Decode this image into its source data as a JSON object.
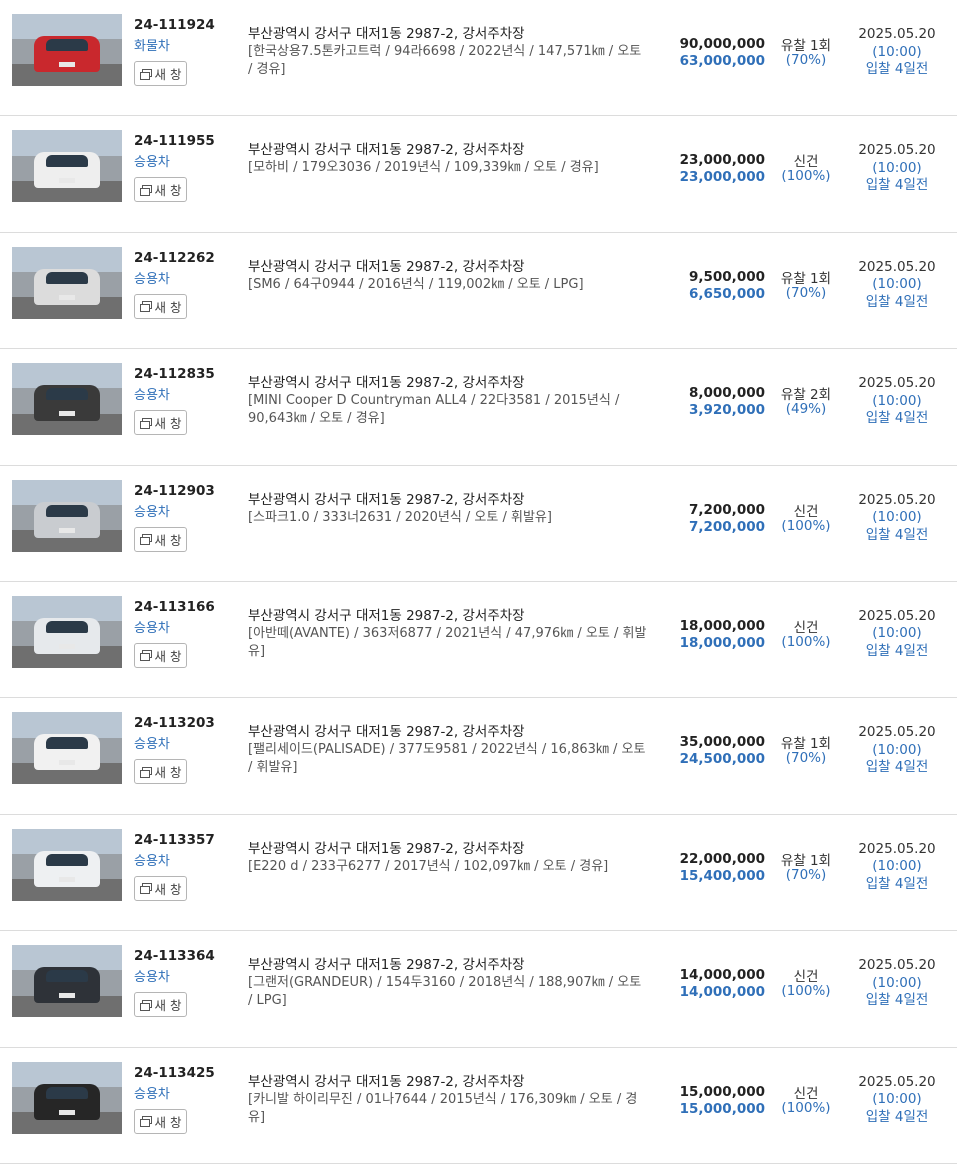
{
  "new_window_label": "새 창",
  "items": [
    {
      "case_no": "24-111924",
      "category": "화물차",
      "address": "부산광역시 강서구 대저1동 2987-2, 강서주차장",
      "spec": "[한국상용7.5톤카고트럭 / 94라6698 / 2022년식 / 147,571㎞ / 오토 / 경유]",
      "appraisal": "90,000,000",
      "min_price": "63,000,000",
      "status": "유찰 1회",
      "percent": "(70%)",
      "date": "2025.05.20",
      "time": "(10:00)",
      "remain": "입찰 4일전",
      "photo_icon": "red-truck-photo",
      "car_color": "#c9282d"
    },
    {
      "case_no": "24-111955",
      "category": "승용차",
      "address": "부산광역시 강서구 대저1동 2987-2, 강서주차장",
      "spec": "[모하비 / 179오3036 / 2019년식 / 109,339㎞ / 오토 / 경유]",
      "appraisal": "23,000,000",
      "min_price": "23,000,000",
      "status": "신건",
      "percent": "(100%)",
      "date": "2025.05.20",
      "time": "(10:00)",
      "remain": "입찰 4일전",
      "photo_icon": "white-suv-photo",
      "car_color": "#eeeeee"
    },
    {
      "case_no": "24-112262",
      "category": "승용차",
      "address": "부산광역시 강서구 대저1동 2987-2, 강서주차장",
      "spec": "[SM6 / 64구0944 / 2016년식 / 119,002㎞ / 오토 / LPG]",
      "appraisal": "9,500,000",
      "min_price": "6,650,000",
      "status": "유찰 1회",
      "percent": "(70%)",
      "date": "2025.05.20",
      "time": "(10:00)",
      "remain": "입찰 4일전",
      "photo_icon": "silver-sedan-photo",
      "car_color": "#dcdcdc"
    },
    {
      "case_no": "24-112835",
      "category": "승용차",
      "address": "부산광역시 강서구 대저1동 2987-2, 강서주차장",
      "spec": "[MINI Cooper D Countryman ALL4 / 22다3581 / 2015년식 / 90,643㎞ / 오토 / 경유]",
      "appraisal": "8,000,000",
      "min_price": "3,920,000",
      "status": "유찰 2회",
      "percent": "(49%)",
      "date": "2025.05.20",
      "time": "(10:00)",
      "remain": "입찰 4일전",
      "photo_icon": "dark-mini-photo",
      "car_color": "#3a3a3a"
    },
    {
      "case_no": "24-112903",
      "category": "승용차",
      "address": "부산광역시 강서구 대저1동 2987-2, 강서주차장",
      "spec": "[스파크1.0 / 333너2631 / 2020년식 / 오토 / 휘발유]",
      "appraisal": "7,200,000",
      "min_price": "7,200,000",
      "status": "신건",
      "percent": "(100%)",
      "date": "2025.05.20",
      "time": "(10:00)",
      "remain": "입찰 4일전",
      "photo_icon": "silver-hatchback-photo",
      "car_color": "#c9ccd0"
    },
    {
      "case_no": "24-113166",
      "category": "승용차",
      "address": "부산광역시 강서구 대저1동 2987-2, 강서주차장",
      "spec": "[아반떼(AVANTE) / 363저6877 / 2021년식 / 47,976㎞ / 오토 / 휘발유]",
      "appraisal": "18,000,000",
      "min_price": "18,000,000",
      "status": "신건",
      "percent": "(100%)",
      "date": "2025.05.20",
      "time": "(10:00)",
      "remain": "입찰 4일전",
      "photo_icon": "white-sedan-photo",
      "car_color": "#e6e9ec"
    },
    {
      "case_no": "24-113203",
      "category": "승용차",
      "address": "부산광역시 강서구 대저1동 2987-2, 강서주차장",
      "spec": "[팰리세이드(PALISADE) / 377도9581 / 2022년식 / 16,863㎞ / 오토 / 휘발유]",
      "appraisal": "35,000,000",
      "min_price": "24,500,000",
      "status": "유찰 1회",
      "percent": "(70%)",
      "date": "2025.05.20",
      "time": "(10:00)",
      "remain": "입찰 4일전",
      "photo_icon": "white-suv-photo",
      "car_color": "#f1f1f1"
    },
    {
      "case_no": "24-113357",
      "category": "승용차",
      "address": "부산광역시 강서구 대저1동 2987-2, 강서주차장",
      "spec": "[E220 d / 233구6277 / 2017년식 / 102,097㎞ / 오토 / 경유]",
      "appraisal": "22,000,000",
      "min_price": "15,400,000",
      "status": "유찰 1회",
      "percent": "(70%)",
      "date": "2025.05.20",
      "time": "(10:00)",
      "remain": "입찰 4일전",
      "photo_icon": "white-sedan-photo",
      "car_color": "#eef0f2"
    },
    {
      "case_no": "24-113364",
      "category": "승용차",
      "address": "부산광역시 강서구 대저1동 2987-2, 강서주차장",
      "spec": "[그랜저(GRANDEUR) / 154두3160 / 2018년식 / 188,907㎞ / 오토 / LPG]",
      "appraisal": "14,000,000",
      "min_price": "14,000,000",
      "status": "신건",
      "percent": "(100%)",
      "date": "2025.05.20",
      "time": "(10:00)",
      "remain": "입찰 4일전",
      "photo_icon": "dark-sedan-photo",
      "car_color": "#2e3238"
    },
    {
      "case_no": "24-113425",
      "category": "승용차",
      "address": "부산광역시 강서구 대저1동 2987-2, 강서주차장",
      "spec": "[카니발 하이리무진 / 01나7644 / 2015년식 / 176,309㎞ / 오토 / 경유]",
      "appraisal": "15,000,000",
      "min_price": "15,000,000",
      "status": "신건",
      "percent": "(100%)",
      "date": "2025.05.20",
      "time": "(10:00)",
      "remain": "입찰 4일전",
      "photo_icon": "dark-van-photo",
      "car_color": "#262626"
    }
  ]
}
